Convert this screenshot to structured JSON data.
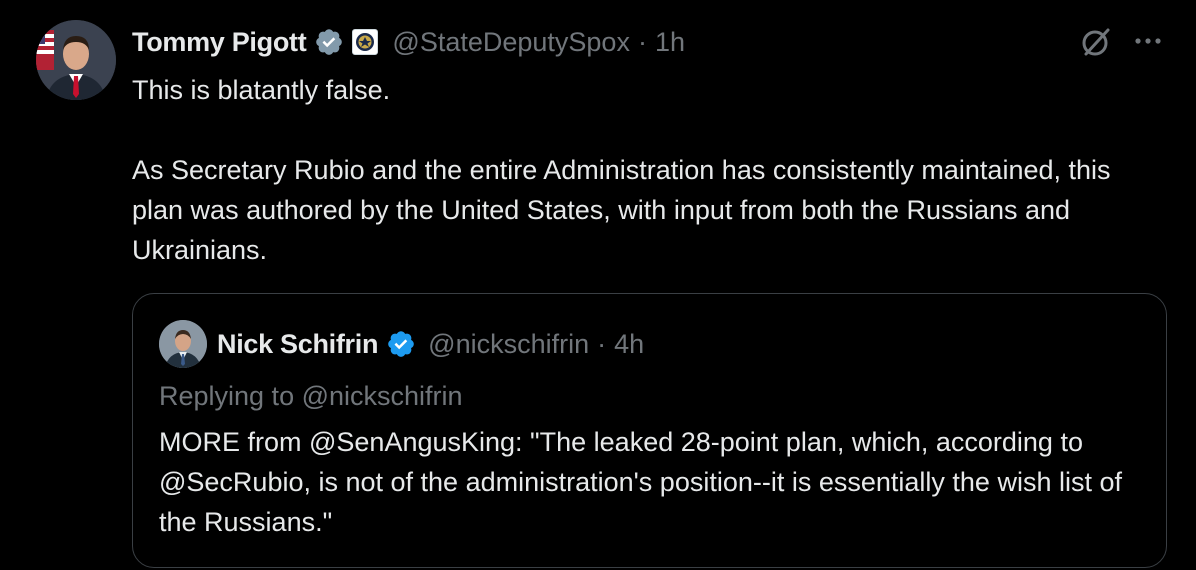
{
  "author": {
    "name": "Tommy Pigott",
    "handle": "@StateDeputySpox",
    "separator": "·",
    "time": "1h",
    "verified_color": "#829aab"
  },
  "post": {
    "line1": "This is blatantly false.",
    "line2": "As Secretary Rubio and the entire Administration has consistently maintained, this plan was authored by the United States, with input from both the Russians and Ukrainians."
  },
  "quoted": {
    "name": "Nick Schifrin",
    "handle": "@nickschifrin",
    "separator": "·",
    "time": "4h",
    "verified_color": "#1d9bf0",
    "replying": "Replying to @nickschifrin",
    "text": "MORE from @SenAngusKing: \"The leaked 28-point plan, which, according to @SecRubio, is not of the administration's position--it is essentially the wish list of the Russians.\""
  },
  "icons": {
    "grok": "grok-icon",
    "more": "more-icon",
    "verified": "verified-badge-icon",
    "affiliation": "state-department-seal-icon"
  },
  "colors": {
    "background": "#000000",
    "text": "#e7e9ea",
    "muted": "#71767b",
    "border": "#3a3f44"
  }
}
